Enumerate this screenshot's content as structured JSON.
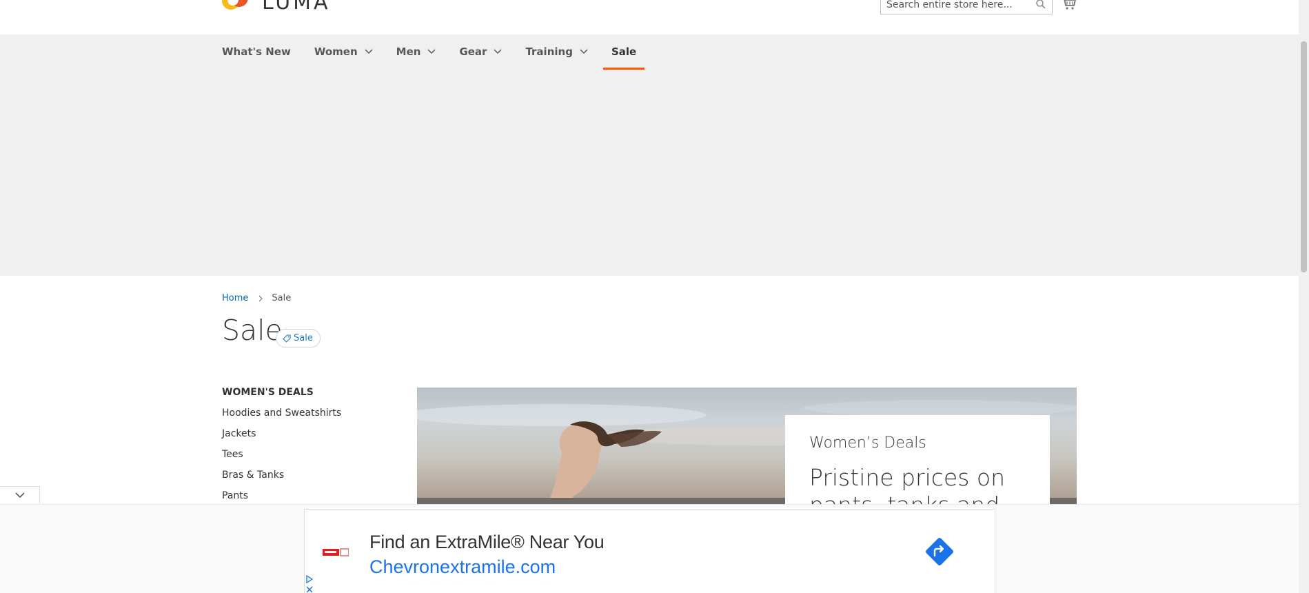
{
  "header": {
    "logo_text": "LUMA",
    "search_placeholder": "Search entire store here..."
  },
  "nav": {
    "items": [
      {
        "label": "What's New",
        "has_dropdown": false
      },
      {
        "label": "Women",
        "has_dropdown": true
      },
      {
        "label": "Men",
        "has_dropdown": true
      },
      {
        "label": "Gear",
        "has_dropdown": true
      },
      {
        "label": "Training",
        "has_dropdown": true
      },
      {
        "label": "Sale",
        "has_dropdown": false,
        "active": true
      }
    ]
  },
  "breadcrumb": {
    "home": "Home",
    "current": "Sale"
  },
  "page": {
    "title": "Sale",
    "badge": "Sale"
  },
  "sidebar": {
    "title": "WOMEN'S DEALS",
    "links": [
      "Hoodies and Sweatshirts",
      "Jackets",
      "Tees",
      "Bras & Tanks",
      "Pants"
    ]
  },
  "hero": {
    "kicker": "Women’s Deals",
    "title": "Pristine prices on pants, tanks and"
  },
  "ad": {
    "headline": "Find an ExtraMile® Near You",
    "url": "Chevronextramile.com",
    "logo_text": "ExtraMile"
  },
  "colors": {
    "accent": "#ff5501",
    "link": "#006bb4",
    "ad_url": "#1a73e8"
  }
}
